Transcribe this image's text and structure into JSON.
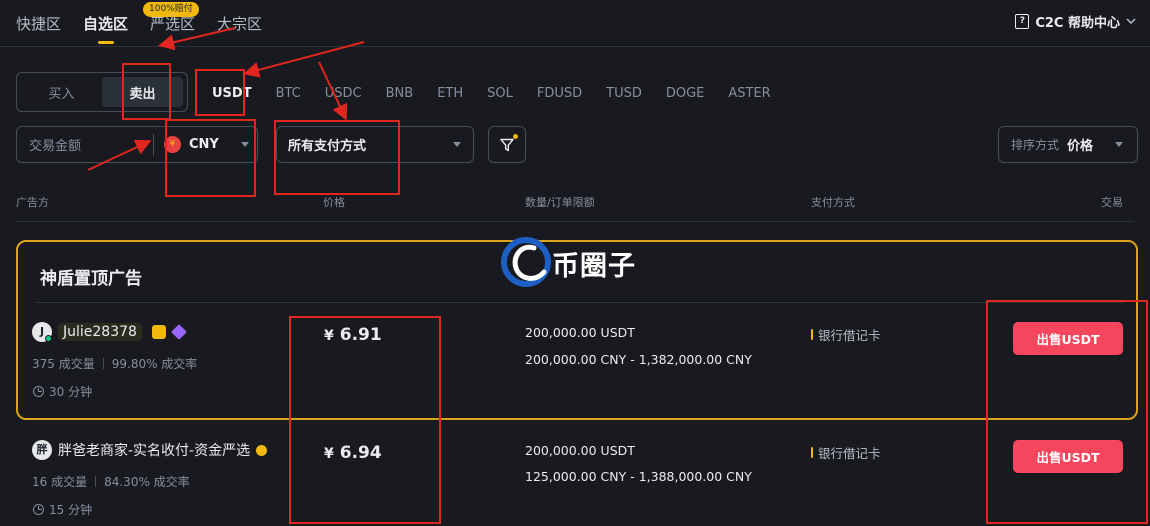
{
  "top_tabs": [
    "快捷区",
    "自选区",
    "严选区",
    "大宗区"
  ],
  "top_tab_active": "自选区",
  "badge": "100%赔付",
  "help": "C2C 帮助中心",
  "side_switch": {
    "buy": "买入",
    "sell": "卖出",
    "active": "卖出"
  },
  "coins": [
    "USDT",
    "BTC",
    "USDC",
    "BNB",
    "ETH",
    "SOL",
    "FDUSD",
    "TUSD",
    "DOGE",
    "ASTER"
  ],
  "coin_active": "USDT",
  "filters": {
    "amount_placeholder": "交易金额",
    "currency_symbol": "¥",
    "currency": "CNY",
    "payment": "所有支付方式",
    "sort_label": "排序方式",
    "sort_value": "价格"
  },
  "table_headers": {
    "advertiser": "广告方",
    "price": "价格",
    "limits": "数量/订单限额",
    "payment": "支付方式",
    "trade": "交易"
  },
  "promo_title": "神盾置顶广告",
  "rows": [
    {
      "avatar": "J",
      "name": "Julie28378",
      "trades": "375 成交量",
      "rate": "99.80% 成交率",
      "time": "30 分钟",
      "currency_symbol": "¥",
      "price": "6.91",
      "quantity": "200,000.00 USDT",
      "limits": "200,000.00 CNY - 1,382,000.00 CNY",
      "payment_method": "银行借记卡",
      "action": "出售USDT"
    },
    {
      "avatar": "胖",
      "name": "胖爸老商家-实名收付-资金严选",
      "trades": "16 成交量",
      "rate": "84.30% 成交率",
      "time": "15 分钟",
      "currency_symbol": "¥",
      "price": "6.94",
      "quantity": "200,000.00 USDT",
      "limits": "125,000.00 CNY - 1,388,000.00 CNY",
      "payment_method": "银行借记卡",
      "action": "出售USDT"
    }
  ],
  "watermark": "币圈子",
  "colors": {
    "background": "#181a20",
    "accent": "#f0b90b",
    "sell": "#f6465d",
    "annotation": "#e0261f"
  }
}
